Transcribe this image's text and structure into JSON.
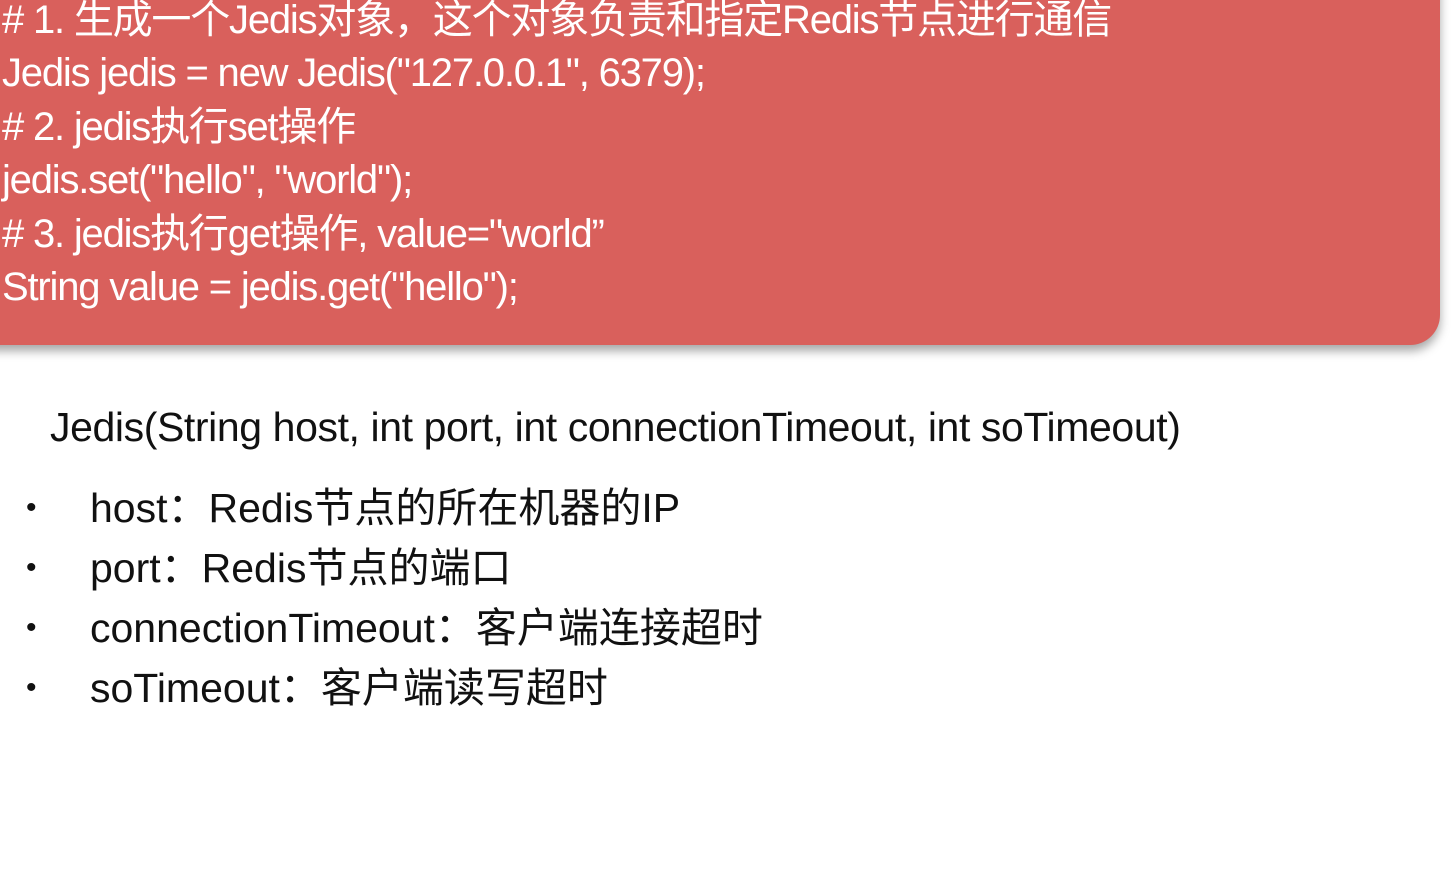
{
  "code_block": {
    "background_color": "#d9605c",
    "lines": [
      "# 1. 生成一个Jedis对象，这个对象负责和指定Redis节点进行通信",
      "Jedis jedis = new Jedis(\"127.0.0.1\", 6379);",
      "# 2. jedis执行set操作",
      "jedis.set(\"hello\", \"world\");",
      "# 3. jedis执行get操作, value=\"world”",
      "String value = jedis.get(\"hello\");"
    ]
  },
  "constructor_signature": "Jedis(String host, int port, int connectionTimeout, int soTimeout)",
  "params": [
    {
      "bullet": "•",
      "text": "host：Redis节点的所在机器的IP"
    },
    {
      "bullet": "•",
      "text": "port：Redis节点的端口"
    },
    {
      "bullet": "•",
      "text": "connectionTimeout：客户端连接超时"
    },
    {
      "bullet": "•",
      "text": "soTimeout：客户端读写超时"
    }
  ]
}
